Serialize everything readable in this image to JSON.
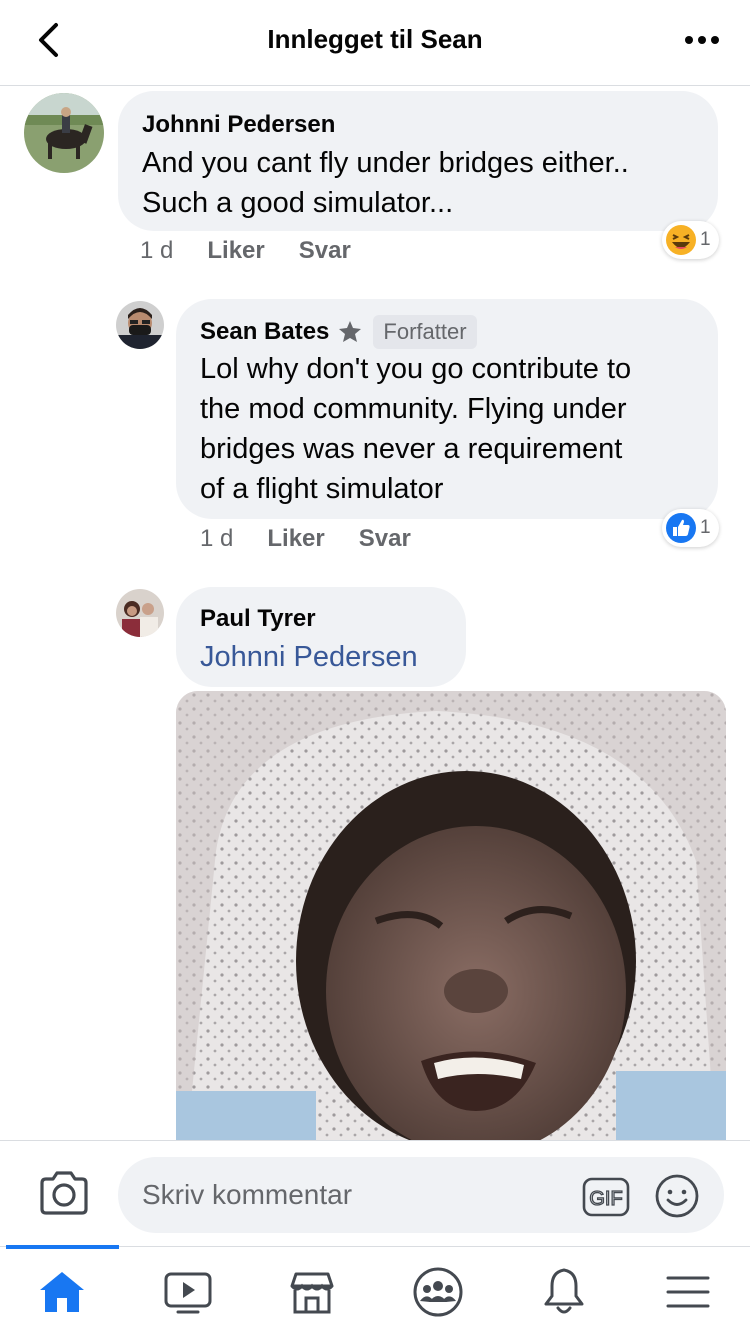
{
  "header": {
    "title": "Innlegget til Sean"
  },
  "comments": [
    {
      "author": "Johnni Pedersen",
      "lines": [
        "And you cant fly under bridges either..",
        "Such a good simulator..."
      ],
      "time": "1 d",
      "like_label": "Liker",
      "reply_label": "Svar",
      "reaction_icon": "haha-icon",
      "reaction_count": "1"
    },
    {
      "author": "Sean Bates",
      "badge": "Forfatter",
      "lines": [
        "Lol why don't you go contribute to",
        "the mod community. Flying under",
        "bridges was never a requirement",
        "of a flight simulator"
      ],
      "time": "1 d",
      "like_label": "Liker",
      "reply_label": "Svar",
      "reaction_icon": "like-icon",
      "reaction_count": "1"
    },
    {
      "author": "Paul Tyrer",
      "mention": "Johnni Pedersen",
      "attachment": "gif-image"
    }
  ],
  "composer": {
    "placeholder": "Skriv kommentar",
    "gif_label": "GIF"
  },
  "tabs": [
    "home-icon",
    "video-icon",
    "marketplace-icon",
    "groups-icon",
    "notifications-icon",
    "menu-icon"
  ],
  "colors": {
    "accent": "#1877f2",
    "link": "#385898",
    "bubble": "#f0f2f5",
    "meta_text": "#65676b"
  }
}
